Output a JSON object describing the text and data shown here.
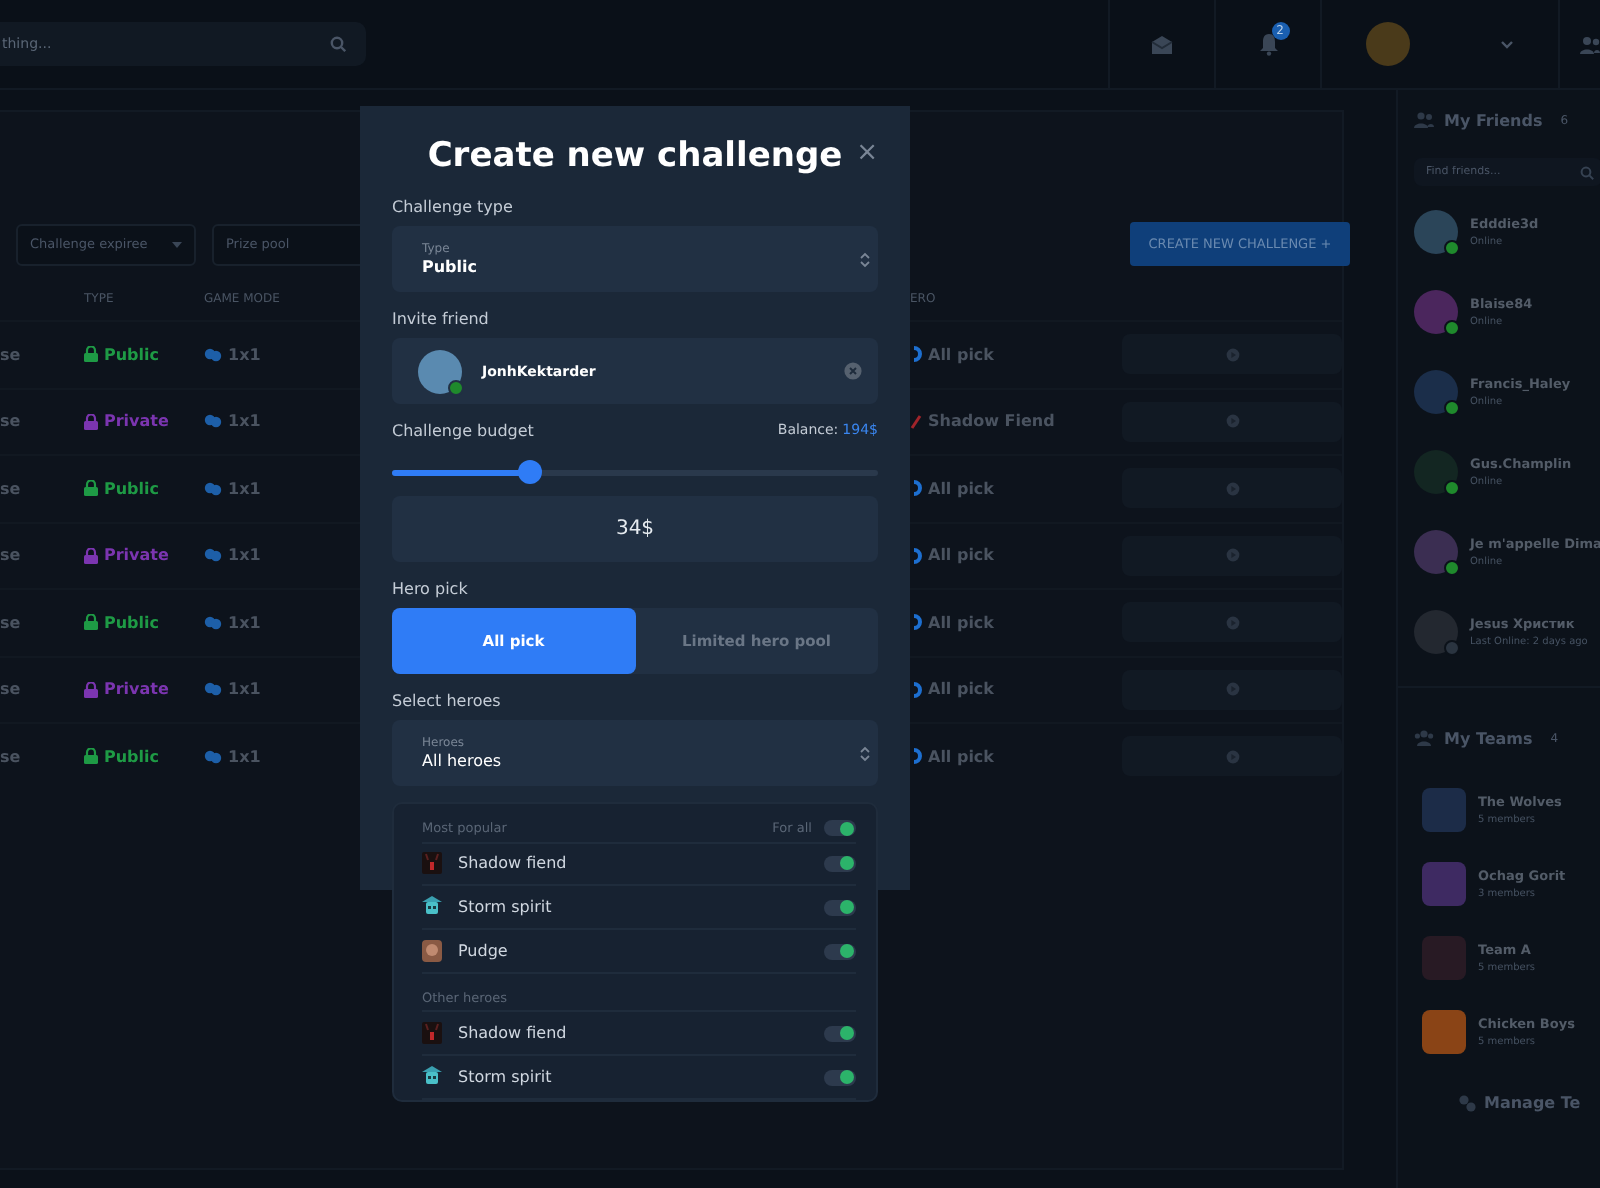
{
  "topbar": {
    "search": {
      "placeholder": "thing..."
    },
    "notifications": "2"
  },
  "filters": [
    "Challenge expiree",
    "Prize pool"
  ],
  "create_button": {
    "label": "CREATE NEW CHALLENGE",
    "icon": "+"
  },
  "table": {
    "columns": [
      "TYPE",
      "GAME MODE",
      "ERO"
    ],
    "rows": [
      {
        "column_1": "se",
        "type": "Public",
        "color": "#1e9a45",
        "mode": "1x1",
        "hero": "All pick",
        "kind": "all_pick"
      },
      {
        "column_1": "se",
        "type": "Private",
        "color": "#7b35b0",
        "mode": "1x1",
        "hero": "Shadow Fiend",
        "kind": "hero"
      },
      {
        "column_1": "se",
        "type": "Public",
        "color": "#1e9a45",
        "mode": "1x1",
        "hero": "All pick",
        "kind": "all_pick"
      },
      {
        "column_1": "se",
        "type": "Private",
        "color": "#7b35b0",
        "mode": "1x1",
        "hero": "All pick",
        "kind": "all_pick"
      },
      {
        "column_1": "se",
        "type": "Public",
        "color": "#1e9a45",
        "mode": "1x1",
        "hero": "All pick",
        "kind": "all_pick"
      },
      {
        "column_1": "se",
        "type": "Private",
        "color": "#7b35b0",
        "mode": "1x1",
        "hero": "All pick",
        "kind": "all_pick"
      },
      {
        "column_1": "se",
        "type": "Public",
        "color": "#1e9a45",
        "mode": "1x1",
        "hero": "All pick",
        "kind": "all_pick"
      }
    ]
  },
  "sidebar": {
    "friends_title": "My Friends",
    "friends_count": "6",
    "search": {
      "placeholder": "Find friends..."
    },
    "friends": [
      {
        "name": "Edddie3d",
        "status": "Online",
        "online": true
      },
      {
        "name": "Blaise84",
        "status": "Online",
        "online": true
      },
      {
        "name": "Francis_Haley",
        "status": "Online",
        "online": true
      },
      {
        "name": "Gus.Champlin",
        "status": "Online",
        "online": true
      },
      {
        "name": "Je m'appelle Dima",
        "status": "Online",
        "online": true
      },
      {
        "name": "Jesus Христик",
        "status": "Last Online: 2 days ago",
        "online": false
      }
    ],
    "teams_title": "My Teams",
    "teams_count": "4",
    "teams": [
      {
        "name": "The Wolves",
        "members": "5 members",
        "color": "#1c2c48"
      },
      {
        "name": "Ochag Gorit",
        "members": "3 members",
        "color": "#3e2a62"
      },
      {
        "name": "Team A",
        "members": "5 members",
        "color": "#281a24"
      },
      {
        "name": "Chicken Boys",
        "members": "5 members",
        "color": "#8a4416"
      }
    ],
    "manage": "Manage Te"
  },
  "modal": {
    "title": "Create new challenge",
    "close": "×",
    "type_label": "Challenge type",
    "type_select": {
      "label": "Type",
      "value": "Public"
    },
    "invite_label": "Invite friend",
    "friend": {
      "name": "JonhKektarder",
      "online": true
    },
    "budget_label": "Challenge budget",
    "balance_label": "Balance:",
    "balance_value": "194$",
    "budget": {
      "level": 0.285,
      "value": "34$"
    },
    "hero_pick_label": "Hero pick",
    "hero_pick": [
      {
        "label": "All pick",
        "selected": true
      },
      {
        "label": "Limited hero pool",
        "selected": false
      }
    ],
    "heroes_label": "Select heroes",
    "heroes_select": {
      "label": "Heroes",
      "value": "All heroes"
    },
    "hero_groups": [
      {
        "title": "Most popular",
        "for_all": {
          "label": "For all",
          "on": true
        },
        "heroes": [
          {
            "name": "Shadow fiend",
            "kind": "fiend",
            "on": true
          },
          {
            "name": "Storm spirit",
            "kind": "spirit",
            "on": true
          },
          {
            "name": "Pudge",
            "kind": "pudge",
            "on": true
          }
        ]
      },
      {
        "title": "Other heroes",
        "heroes": [
          {
            "name": "Shadow fiend",
            "kind": "fiend",
            "on": true
          },
          {
            "name": "Storm spirit",
            "kind": "spirit",
            "on": true
          }
        ]
      }
    ]
  }
}
